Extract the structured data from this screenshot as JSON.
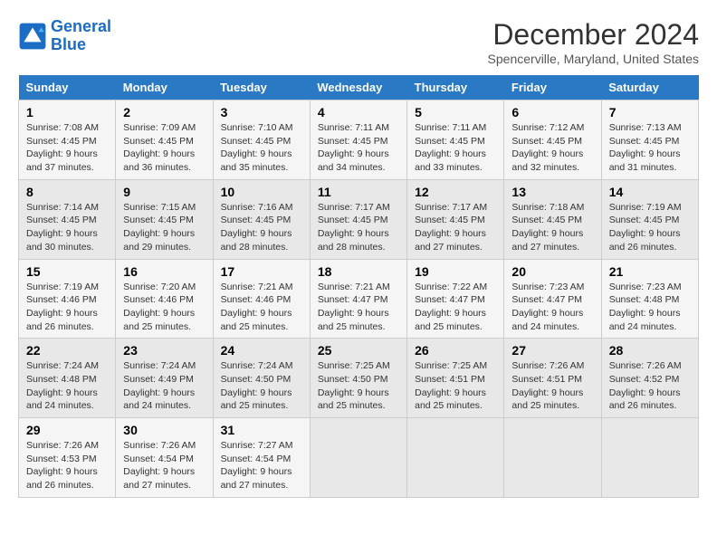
{
  "logo": {
    "line1": "General",
    "line2": "Blue"
  },
  "title": "December 2024",
  "location": "Spencerville, Maryland, United States",
  "columns": [
    "Sunday",
    "Monday",
    "Tuesday",
    "Wednesday",
    "Thursday",
    "Friday",
    "Saturday"
  ],
  "weeks": [
    [
      {
        "day": "1",
        "rise": "7:08 AM",
        "set": "4:45 PM",
        "daylight": "9 hours and 37 minutes."
      },
      {
        "day": "2",
        "rise": "7:09 AM",
        "set": "4:45 PM",
        "daylight": "9 hours and 36 minutes."
      },
      {
        "day": "3",
        "rise": "7:10 AM",
        "set": "4:45 PM",
        "daylight": "9 hours and 35 minutes."
      },
      {
        "day": "4",
        "rise": "7:11 AM",
        "set": "4:45 PM",
        "daylight": "9 hours and 34 minutes."
      },
      {
        "day": "5",
        "rise": "7:11 AM",
        "set": "4:45 PM",
        "daylight": "9 hours and 33 minutes."
      },
      {
        "day": "6",
        "rise": "7:12 AM",
        "set": "4:45 PM",
        "daylight": "9 hours and 32 minutes."
      },
      {
        "day": "7",
        "rise": "7:13 AM",
        "set": "4:45 PM",
        "daylight": "9 hours and 31 minutes."
      }
    ],
    [
      {
        "day": "8",
        "rise": "7:14 AM",
        "set": "4:45 PM",
        "daylight": "9 hours and 30 minutes."
      },
      {
        "day": "9",
        "rise": "7:15 AM",
        "set": "4:45 PM",
        "daylight": "9 hours and 29 minutes."
      },
      {
        "day": "10",
        "rise": "7:16 AM",
        "set": "4:45 PM",
        "daylight": "9 hours and 28 minutes."
      },
      {
        "day": "11",
        "rise": "7:17 AM",
        "set": "4:45 PM",
        "daylight": "9 hours and 28 minutes."
      },
      {
        "day": "12",
        "rise": "7:17 AM",
        "set": "4:45 PM",
        "daylight": "9 hours and 27 minutes."
      },
      {
        "day": "13",
        "rise": "7:18 AM",
        "set": "4:45 PM",
        "daylight": "9 hours and 27 minutes."
      },
      {
        "day": "14",
        "rise": "7:19 AM",
        "set": "4:45 PM",
        "daylight": "9 hours and 26 minutes."
      }
    ],
    [
      {
        "day": "15",
        "rise": "7:19 AM",
        "set": "4:46 PM",
        "daylight": "9 hours and 26 minutes."
      },
      {
        "day": "16",
        "rise": "7:20 AM",
        "set": "4:46 PM",
        "daylight": "9 hours and 25 minutes."
      },
      {
        "day": "17",
        "rise": "7:21 AM",
        "set": "4:46 PM",
        "daylight": "9 hours and 25 minutes."
      },
      {
        "day": "18",
        "rise": "7:21 AM",
        "set": "4:47 PM",
        "daylight": "9 hours and 25 minutes."
      },
      {
        "day": "19",
        "rise": "7:22 AM",
        "set": "4:47 PM",
        "daylight": "9 hours and 25 minutes."
      },
      {
        "day": "20",
        "rise": "7:23 AM",
        "set": "4:47 PM",
        "daylight": "9 hours and 24 minutes."
      },
      {
        "day": "21",
        "rise": "7:23 AM",
        "set": "4:48 PM",
        "daylight": "9 hours and 24 minutes."
      }
    ],
    [
      {
        "day": "22",
        "rise": "7:24 AM",
        "set": "4:48 PM",
        "daylight": "9 hours and 24 minutes."
      },
      {
        "day": "23",
        "rise": "7:24 AM",
        "set": "4:49 PM",
        "daylight": "9 hours and 24 minutes."
      },
      {
        "day": "24",
        "rise": "7:24 AM",
        "set": "4:50 PM",
        "daylight": "9 hours and 25 minutes."
      },
      {
        "day": "25",
        "rise": "7:25 AM",
        "set": "4:50 PM",
        "daylight": "9 hours and 25 minutes."
      },
      {
        "day": "26",
        "rise": "7:25 AM",
        "set": "4:51 PM",
        "daylight": "9 hours and 25 minutes."
      },
      {
        "day": "27",
        "rise": "7:26 AM",
        "set": "4:51 PM",
        "daylight": "9 hours and 25 minutes."
      },
      {
        "day": "28",
        "rise": "7:26 AM",
        "set": "4:52 PM",
        "daylight": "9 hours and 26 minutes."
      }
    ],
    [
      {
        "day": "29",
        "rise": "7:26 AM",
        "set": "4:53 PM",
        "daylight": "9 hours and 26 minutes."
      },
      {
        "day": "30",
        "rise": "7:26 AM",
        "set": "4:54 PM",
        "daylight": "9 hours and 27 minutes."
      },
      {
        "day": "31",
        "rise": "7:27 AM",
        "set": "4:54 PM",
        "daylight": "9 hours and 27 minutes."
      },
      null,
      null,
      null,
      null
    ]
  ],
  "labels": {
    "sunrise": "Sunrise:",
    "sunset": "Sunset:",
    "daylight": "Daylight:"
  }
}
